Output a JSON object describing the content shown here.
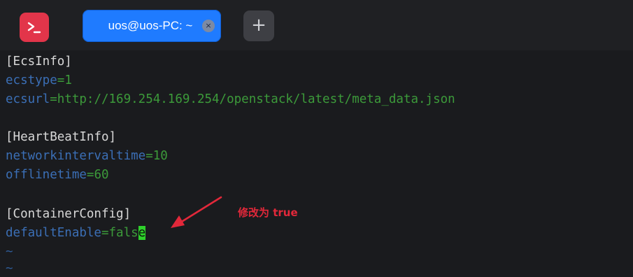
{
  "window": {
    "app_icon": "terminal-icon",
    "tab": {
      "title": "uos@uos-PC: ~",
      "close_symbol": "×"
    },
    "new_tab_symbol": "+"
  },
  "terminal": {
    "lines": [
      {
        "type": "section",
        "text": "[EcsInfo]"
      },
      {
        "type": "kv",
        "key": "ecstype",
        "sep": "=",
        "value": "1"
      },
      {
        "type": "kv",
        "key": "ecsurl",
        "sep": "=",
        "value": "http://169.254.169.254/openstack/latest/meta_data.json"
      },
      {
        "type": "blank",
        "text": ""
      },
      {
        "type": "section",
        "text": "[HeartBeatInfo]"
      },
      {
        "type": "kv",
        "key": "networkintervaltime",
        "sep": "=",
        "value": "10"
      },
      {
        "type": "kv",
        "key": "offlinetime",
        "sep": "=",
        "value": "60"
      },
      {
        "type": "blank",
        "text": ""
      },
      {
        "type": "section",
        "text": "[ContainerConfig]"
      },
      {
        "type": "kv",
        "key": "defaultEnable",
        "sep": "=",
        "value": "fals",
        "cursor_char": "e"
      },
      {
        "type": "tilde",
        "text": "~"
      },
      {
        "type": "tilde",
        "text": "~"
      }
    ]
  },
  "annotation": {
    "text": "修改为 true",
    "color": "#e2283a"
  },
  "colors": {
    "background": "#1a1b1e",
    "tab_active": "#1f7bff",
    "app_icon": "#e2354a",
    "key": "#3b6fb6",
    "value": "#3c9a3a",
    "cursor": "#2ed12b"
  }
}
